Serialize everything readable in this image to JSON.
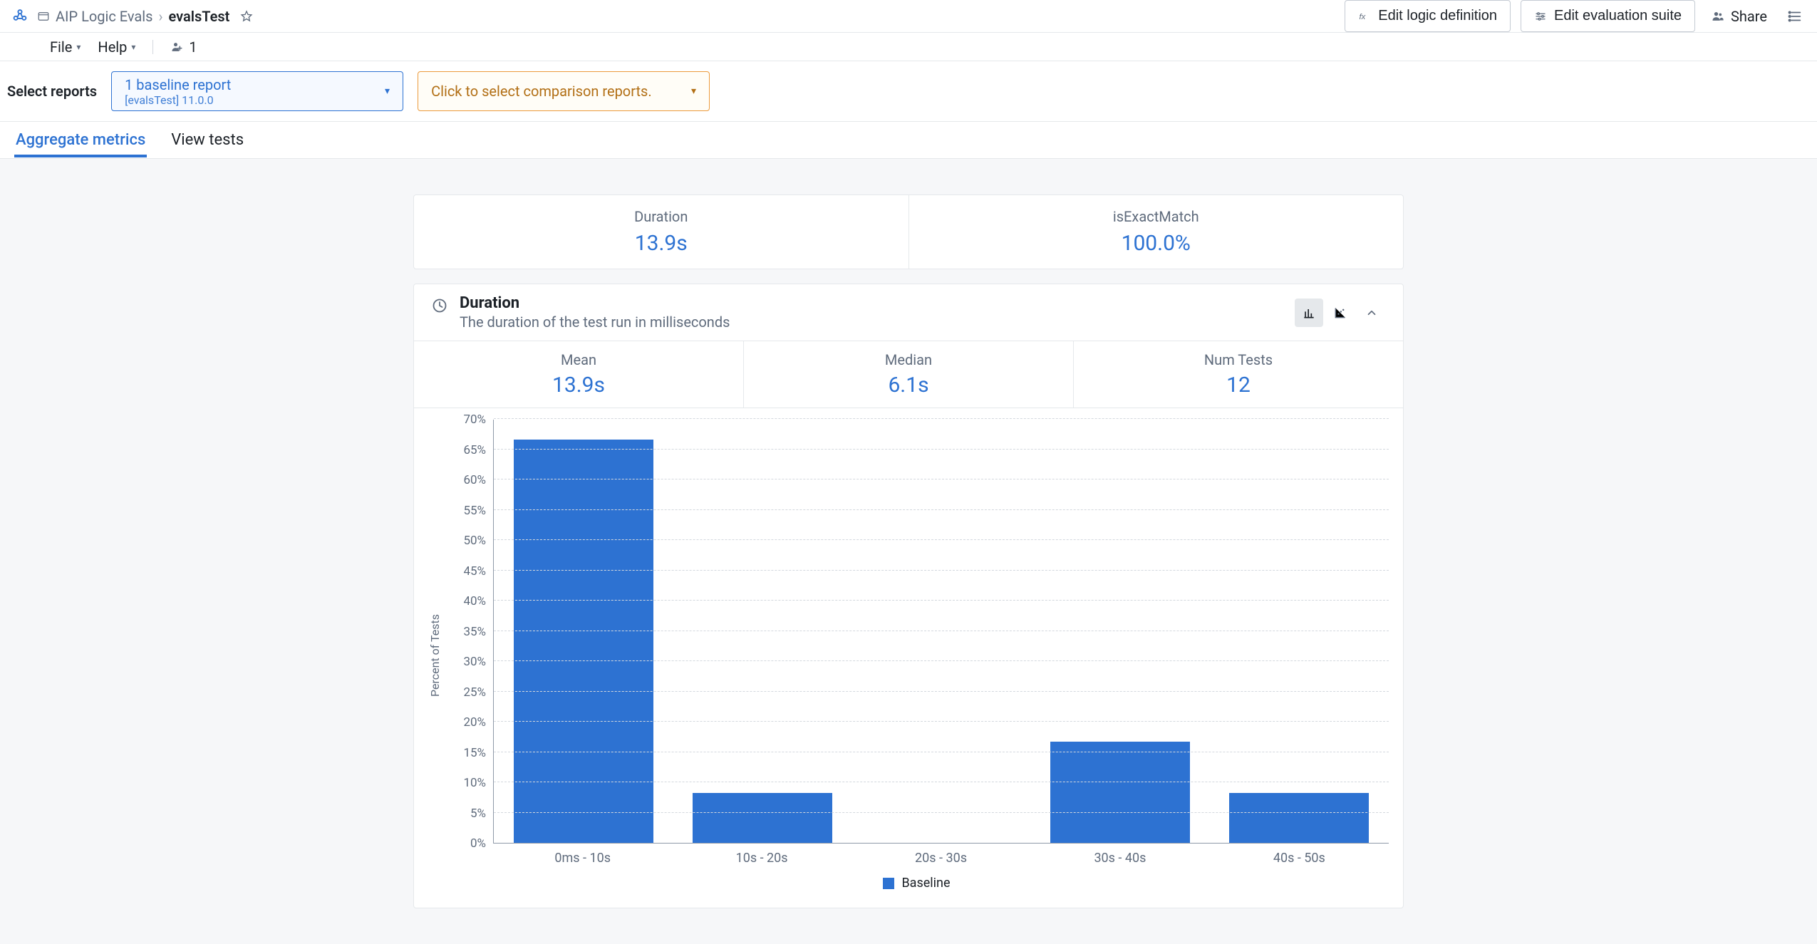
{
  "breadcrumb": {
    "parent": "AIP Logic Evals",
    "current": "evalsTest"
  },
  "header": {
    "edit_logic_label": "Edit logic definition",
    "edit_eval_label": "Edit evaluation suite",
    "share_label": "Share"
  },
  "menubar": {
    "file": "File",
    "help": "Help",
    "presence_count": "1"
  },
  "reportsbar": {
    "label": "Select reports",
    "baseline": {
      "title": "1 baseline report",
      "subtitle": "[evalsTest] 11.0.0"
    },
    "comparison_placeholder": "Click to select comparison reports."
  },
  "tabs": {
    "aggregate": "Aggregate metrics",
    "view_tests": "View tests"
  },
  "summary": {
    "duration_label": "Duration",
    "duration_value": "13.9s",
    "exact_label": "isExactMatch",
    "exact_value": "100.0%"
  },
  "duration_card": {
    "title": "Duration",
    "desc": "The duration of the test run in milliseconds",
    "mean_label": "Mean",
    "mean_value": "13.9s",
    "median_label": "Median",
    "median_value": "6.1s",
    "numtests_label": "Num Tests",
    "numtests_value": "12"
  },
  "chart_data": {
    "type": "bar",
    "title": "Duration",
    "xlabel": "",
    "ylabel": "Percent of Tests",
    "ylim": [
      0,
      70
    ],
    "yticks": [
      0,
      5,
      10,
      15,
      20,
      25,
      30,
      35,
      40,
      45,
      50,
      55,
      60,
      65,
      70
    ],
    "categories": [
      "0ms - 10s",
      "10s - 20s",
      "20s - 30s",
      "30s - 40s",
      "40s - 50s"
    ],
    "series": [
      {
        "name": "Baseline",
        "values": [
          66.7,
          8.3,
          0,
          16.7,
          8.3
        ],
        "color": "#2D72D2"
      }
    ],
    "legend": "Baseline"
  }
}
